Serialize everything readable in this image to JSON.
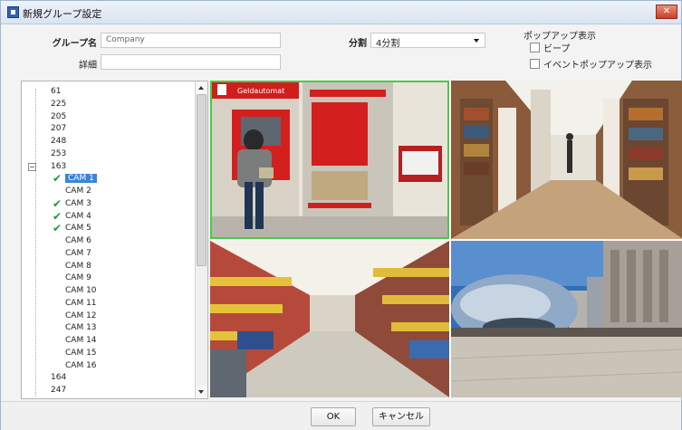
{
  "window": {
    "title": "新規グループ設定",
    "close_icon": "close-icon"
  },
  "form": {
    "group_name_label": "グループ名",
    "group_name_value": "Company",
    "detail_label": "詳細",
    "detail_value": "",
    "split_label": "分割",
    "split_value": "4分割"
  },
  "popup": {
    "title": "ポップアップ表示",
    "beep_label": "ビープ",
    "beep_checked": false,
    "event_popup_label": "イベントポップアップ表示",
    "event_popup_checked": false
  },
  "tree": {
    "items": [
      {
        "label": "61",
        "checked": false,
        "selected": false
      },
      {
        "label": "225",
        "checked": false,
        "selected": false
      },
      {
        "label": "205",
        "checked": false,
        "selected": false
      },
      {
        "label": "207",
        "checked": false,
        "selected": false
      },
      {
        "label": "248",
        "checked": false,
        "selected": false
      },
      {
        "label": "253",
        "checked": false,
        "selected": false
      },
      {
        "label": "163",
        "checked": false,
        "selected": false,
        "expanded": true
      },
      {
        "label": "CAM 1",
        "checked": true,
        "selected": true
      },
      {
        "label": "CAM 2",
        "checked": false,
        "selected": false
      },
      {
        "label": "CAM 3",
        "checked": true,
        "selected": false
      },
      {
        "label": "CAM 4",
        "checked": true,
        "selected": false
      },
      {
        "label": "CAM 5",
        "checked": true,
        "selected": false
      },
      {
        "label": "CAM 6",
        "checked": false,
        "selected": false
      },
      {
        "label": "CAM 7",
        "checked": false,
        "selected": false
      },
      {
        "label": "CAM 8",
        "checked": false,
        "selected": false
      },
      {
        "label": "CAM 9",
        "checked": false,
        "selected": false
      },
      {
        "label": "CAM 10",
        "checked": false,
        "selected": false
      },
      {
        "label": "CAM 11",
        "checked": false,
        "selected": false
      },
      {
        "label": "CAM 12",
        "checked": false,
        "selected": false
      },
      {
        "label": "CAM 13",
        "checked": false,
        "selected": false
      },
      {
        "label": "CAM 14",
        "checked": false,
        "selected": false
      },
      {
        "label": "CAM 15",
        "checked": false,
        "selected": false
      },
      {
        "label": "CAM 16",
        "checked": false,
        "selected": false
      },
      {
        "label": "164",
        "checked": false,
        "selected": false
      },
      {
        "label": "247",
        "checked": false,
        "selected": false
      }
    ]
  },
  "cameras": {
    "cam1_sign": "Geldautomat"
  },
  "buttons": {
    "ok_label": "OK",
    "cancel_label": "キャンセル"
  },
  "colors": {
    "selection": "#3a84d8",
    "check": "#1c9b36",
    "active_border": "#44cc44"
  }
}
